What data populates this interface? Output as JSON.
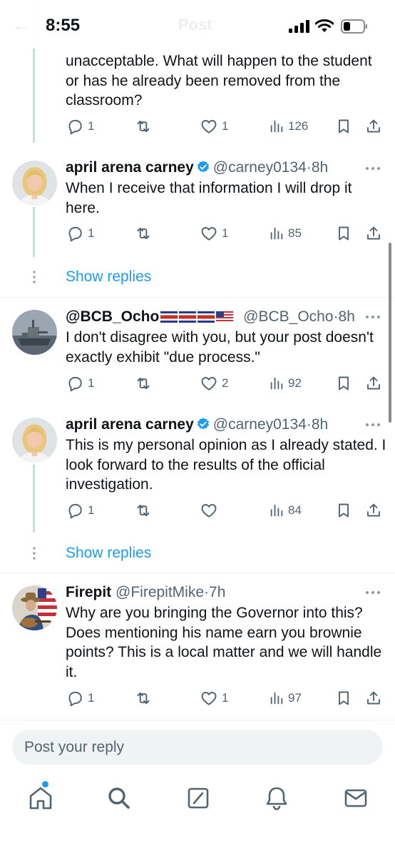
{
  "status_bar": {
    "time": "8:55",
    "faint_title": "Post"
  },
  "colors": {
    "accent": "#1d9bf0",
    "text": "#0f1419",
    "muted": "#536471",
    "verified": "#1d9bf0",
    "thread_line": "#cfd9de"
  },
  "tweets": [
    {
      "text_partial": "unacceptable. What will happen to the student or has he already been removed from the classroom?",
      "actions": {
        "replies": "1",
        "reposts": "",
        "likes": "1",
        "views": "126"
      }
    },
    {
      "name": "april arena carney",
      "verified": true,
      "handle": "@carney0134",
      "sep": "·",
      "time": "8h",
      "text": "When I receive that information I will drop it here.",
      "actions": {
        "replies": "1",
        "reposts": "",
        "likes": "1",
        "views": "85"
      },
      "avatar_icon": "woman-portrait-avatar"
    },
    {
      "name": "@BCB_Ocho",
      "flags": [
        "costa-rica-flag",
        "costa-rica-flag",
        "costa-rica-flag",
        "usa-flag"
      ],
      "handle": "@BCB_Ocho",
      "sep": "·",
      "time": "8h",
      "text": "I don't disagree with you, but your post doesn't exactly exhibit \"due process.\"",
      "actions": {
        "replies": "1",
        "reposts": "",
        "likes": "2",
        "views": "92"
      },
      "avatar_icon": "ship-avatar"
    },
    {
      "name": "april arena carney",
      "verified": true,
      "handle": "@carney0134",
      "sep": "·",
      "time": "8h",
      "text": "This is my personal opinion as I already stated. I look forward to the results of the official investigation.",
      "actions": {
        "replies": "1",
        "reposts": "",
        "likes": "",
        "views": "84"
      },
      "avatar_icon": "woman-portrait-avatar"
    },
    {
      "name": "Firepit",
      "handle": "@FirepitMike",
      "sep": "·",
      "time": "7h",
      "text": "Why are you bringing the Governor into this? Does mentioning his name earn you brownie points? This is a local matter and we will handle it.",
      "actions": {
        "replies": "1",
        "reposts": "",
        "likes": "1",
        "views": "97"
      },
      "avatar_icon": "guitar-player-flag-avatar"
    }
  ],
  "show_replies_label": "Show replies",
  "reply_box": {
    "placeholder": "Post your reply"
  },
  "bottom_nav": [
    {
      "name": "home",
      "icon": "home-icon",
      "has_notification_dot": true
    },
    {
      "name": "search",
      "icon": "search-icon"
    },
    {
      "name": "grok",
      "icon": "grok-icon"
    },
    {
      "name": "notifications",
      "icon": "bell-icon"
    },
    {
      "name": "messages",
      "icon": "mail-icon"
    }
  ]
}
